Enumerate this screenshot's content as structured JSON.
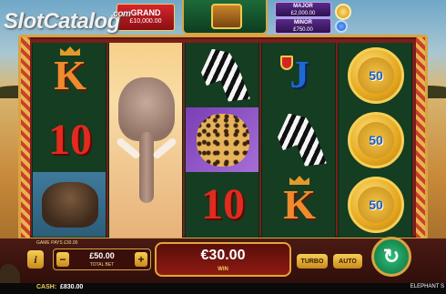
{
  "watermark": {
    "brand": "SlotCatalog",
    "suffix": ".com"
  },
  "jackpots": {
    "grand": {
      "label": "GRAND",
      "amount": "£10,000.00"
    },
    "major": {
      "label": "MAJOR",
      "amount": "£2,000.00"
    },
    "minor": {
      "label": "MINOR",
      "amount": "£750.00"
    }
  },
  "reels": [
    [
      "K",
      "10",
      "buffalo"
    ],
    [
      "elephant"
    ],
    [
      "zebra",
      "cheetah",
      "10"
    ],
    [
      "J",
      "zebra",
      "K"
    ],
    [
      "coin",
      "coin",
      "coin"
    ]
  ],
  "coin_value": "50",
  "controls": {
    "game_pays": "GAME PAYS £30.00",
    "info": "i",
    "bet_value": "£50.00",
    "bet_label": "TOTAL BET",
    "minus": "−",
    "plus": "+",
    "win_value": "€30.00",
    "win_label": "WIN",
    "turbo": "TURBO",
    "auto": "AUTO",
    "spin_icon": "↻"
  },
  "status": {
    "cash_label": "CASH:",
    "cash_value": "£830.00",
    "game_name": "ELEPHANT S"
  },
  "colors": {
    "grand": "#d4262e",
    "jackpot": "#5a2a8a",
    "spin": "#2fc07a",
    "gold": "#d9a441"
  }
}
